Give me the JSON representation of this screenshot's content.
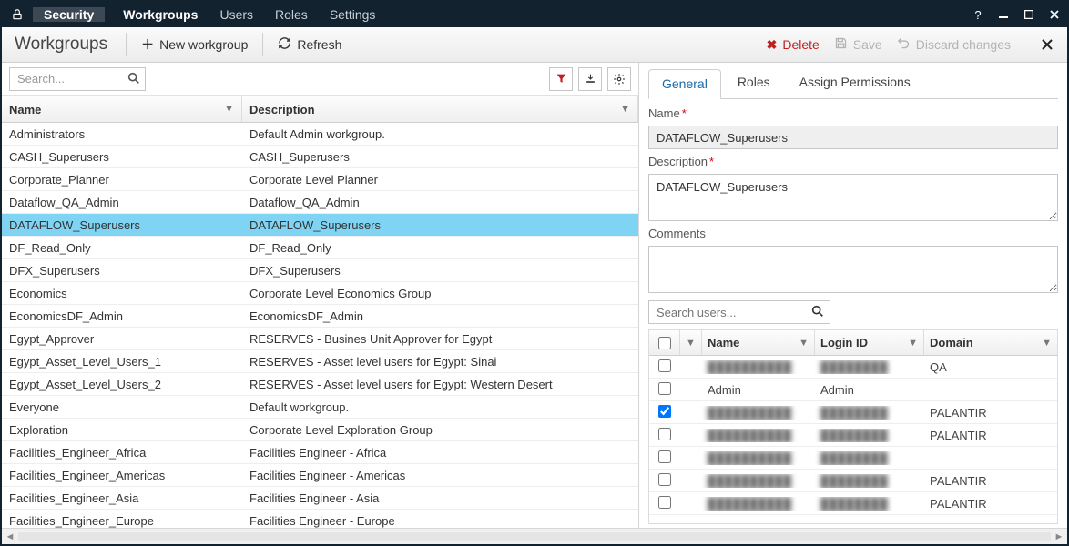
{
  "titlebar": {
    "app": "Security",
    "tabs": [
      {
        "label": "Workgroups",
        "active": true
      },
      {
        "label": "Users",
        "active": false
      },
      {
        "label": "Roles",
        "active": false
      },
      {
        "label": "Settings",
        "active": false
      }
    ]
  },
  "toolbar": {
    "heading": "Workgroups",
    "new_label": "New workgroup",
    "refresh_label": "Refresh",
    "delete_label": "Delete",
    "save_label": "Save",
    "discard_label": "Discard changes"
  },
  "left_search_placeholder": "Search...",
  "grid": {
    "cols": {
      "name": "Name",
      "desc": "Description"
    },
    "rows": [
      {
        "name": "Administrators",
        "desc": "Default Admin workgroup.",
        "sel": false
      },
      {
        "name": "CASH_Superusers",
        "desc": "CASH_Superusers",
        "sel": false
      },
      {
        "name": "Corporate_Planner",
        "desc": "Corporate Level Planner",
        "sel": false
      },
      {
        "name": "Dataflow_QA_Admin",
        "desc": "Dataflow_QA_Admin",
        "sel": false
      },
      {
        "name": "DATAFLOW_Superusers",
        "desc": "DATAFLOW_Superusers",
        "sel": true
      },
      {
        "name": "DF_Read_Only",
        "desc": "DF_Read_Only",
        "sel": false
      },
      {
        "name": "DFX_Superusers",
        "desc": "DFX_Superusers",
        "sel": false
      },
      {
        "name": "Economics",
        "desc": "Corporate Level Economics Group",
        "sel": false
      },
      {
        "name": "EconomicsDF_Admin",
        "desc": "EconomicsDF_Admin",
        "sel": false
      },
      {
        "name": "Egypt_Approver",
        "desc": "RESERVES - Busines Unit Approver for Egypt",
        "sel": false
      },
      {
        "name": "Egypt_Asset_Level_Users_1",
        "desc": "RESERVES - Asset level users for Egypt: Sinai",
        "sel": false
      },
      {
        "name": "Egypt_Asset_Level_Users_2",
        "desc": "RESERVES - Asset level users for Egypt: Western Desert",
        "sel": false
      },
      {
        "name": "Everyone",
        "desc": "Default workgroup.",
        "sel": false
      },
      {
        "name": "Exploration",
        "desc": "Corporate Level Exploration Group",
        "sel": false
      },
      {
        "name": "Facilities_Engineer_Africa",
        "desc": "Facilities Engineer - Africa",
        "sel": false
      },
      {
        "name": "Facilities_Engineer_Americas",
        "desc": "Facilities Engineer - Americas",
        "sel": false
      },
      {
        "name": "Facilities_Engineer_Asia",
        "desc": "Facilities Engineer - Asia",
        "sel": false
      },
      {
        "name": "Facilities_Engineer_Europe",
        "desc": "Facilities Engineer - Europe",
        "sel": false
      }
    ]
  },
  "detail_tabs": [
    {
      "label": "General",
      "active": true
    },
    {
      "label": "Roles",
      "active": false
    },
    {
      "label": "Assign Permissions",
      "active": false
    }
  ],
  "form": {
    "name_label": "Name",
    "name_value": "DATAFLOW_Superusers",
    "desc_label": "Description",
    "desc_value": "DATAFLOW_Superusers",
    "comments_label": "Comments",
    "comments_value": ""
  },
  "user_search_placeholder": "Search users...",
  "ugrid": {
    "cols": {
      "name": "Name",
      "login": "Login ID",
      "domain": "Domain"
    },
    "rows": [
      {
        "checked": false,
        "name": "—",
        "login": "—",
        "domain": "QA",
        "redact": true
      },
      {
        "checked": false,
        "name": "Admin",
        "login": "Admin",
        "domain": "",
        "redact": false
      },
      {
        "checked": true,
        "name": "—",
        "login": "—",
        "domain": "PALANTIR",
        "redact": true
      },
      {
        "checked": false,
        "name": "—",
        "login": "—",
        "domain": "PALANTIR",
        "redact": true
      },
      {
        "checked": false,
        "name": "—",
        "login": "—",
        "domain": "",
        "redact": true
      },
      {
        "checked": false,
        "name": "—",
        "login": "—",
        "domain": "PALANTIR",
        "redact": true
      },
      {
        "checked": false,
        "name": "—",
        "login": "—",
        "domain": "PALANTIR",
        "redact": true
      }
    ]
  }
}
